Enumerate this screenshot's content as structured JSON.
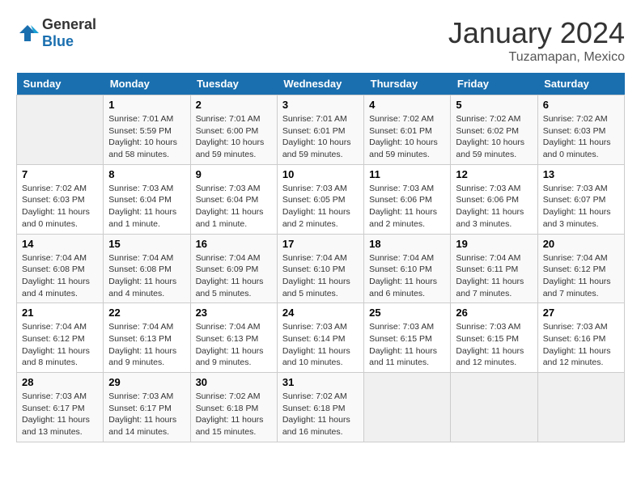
{
  "header": {
    "logo_general": "General",
    "logo_blue": "Blue",
    "month_title": "January 2024",
    "location": "Tuzamapan, Mexico"
  },
  "weekdays": [
    "Sunday",
    "Monday",
    "Tuesday",
    "Wednesday",
    "Thursday",
    "Friday",
    "Saturday"
  ],
  "weeks": [
    [
      {
        "day": "",
        "info": ""
      },
      {
        "day": "1",
        "info": "Sunrise: 7:01 AM\nSunset: 5:59 PM\nDaylight: 10 hours\nand 58 minutes."
      },
      {
        "day": "2",
        "info": "Sunrise: 7:01 AM\nSunset: 6:00 PM\nDaylight: 10 hours\nand 59 minutes."
      },
      {
        "day": "3",
        "info": "Sunrise: 7:01 AM\nSunset: 6:01 PM\nDaylight: 10 hours\nand 59 minutes."
      },
      {
        "day": "4",
        "info": "Sunrise: 7:02 AM\nSunset: 6:01 PM\nDaylight: 10 hours\nand 59 minutes."
      },
      {
        "day": "5",
        "info": "Sunrise: 7:02 AM\nSunset: 6:02 PM\nDaylight: 10 hours\nand 59 minutes."
      },
      {
        "day": "6",
        "info": "Sunrise: 7:02 AM\nSunset: 6:03 PM\nDaylight: 11 hours\nand 0 minutes."
      }
    ],
    [
      {
        "day": "7",
        "info": "Sunrise: 7:02 AM\nSunset: 6:03 PM\nDaylight: 11 hours\nand 0 minutes."
      },
      {
        "day": "8",
        "info": "Sunrise: 7:03 AM\nSunset: 6:04 PM\nDaylight: 11 hours\nand 1 minute."
      },
      {
        "day": "9",
        "info": "Sunrise: 7:03 AM\nSunset: 6:04 PM\nDaylight: 11 hours\nand 1 minute."
      },
      {
        "day": "10",
        "info": "Sunrise: 7:03 AM\nSunset: 6:05 PM\nDaylight: 11 hours\nand 2 minutes."
      },
      {
        "day": "11",
        "info": "Sunrise: 7:03 AM\nSunset: 6:06 PM\nDaylight: 11 hours\nand 2 minutes."
      },
      {
        "day": "12",
        "info": "Sunrise: 7:03 AM\nSunset: 6:06 PM\nDaylight: 11 hours\nand 3 minutes."
      },
      {
        "day": "13",
        "info": "Sunrise: 7:03 AM\nSunset: 6:07 PM\nDaylight: 11 hours\nand 3 minutes."
      }
    ],
    [
      {
        "day": "14",
        "info": "Sunrise: 7:04 AM\nSunset: 6:08 PM\nDaylight: 11 hours\nand 4 minutes."
      },
      {
        "day": "15",
        "info": "Sunrise: 7:04 AM\nSunset: 6:08 PM\nDaylight: 11 hours\nand 4 minutes."
      },
      {
        "day": "16",
        "info": "Sunrise: 7:04 AM\nSunset: 6:09 PM\nDaylight: 11 hours\nand 5 minutes."
      },
      {
        "day": "17",
        "info": "Sunrise: 7:04 AM\nSunset: 6:10 PM\nDaylight: 11 hours\nand 5 minutes."
      },
      {
        "day": "18",
        "info": "Sunrise: 7:04 AM\nSunset: 6:10 PM\nDaylight: 11 hours\nand 6 minutes."
      },
      {
        "day": "19",
        "info": "Sunrise: 7:04 AM\nSunset: 6:11 PM\nDaylight: 11 hours\nand 7 minutes."
      },
      {
        "day": "20",
        "info": "Sunrise: 7:04 AM\nSunset: 6:12 PM\nDaylight: 11 hours\nand 7 minutes."
      }
    ],
    [
      {
        "day": "21",
        "info": "Sunrise: 7:04 AM\nSunset: 6:12 PM\nDaylight: 11 hours\nand 8 minutes."
      },
      {
        "day": "22",
        "info": "Sunrise: 7:04 AM\nSunset: 6:13 PM\nDaylight: 11 hours\nand 9 minutes."
      },
      {
        "day": "23",
        "info": "Sunrise: 7:04 AM\nSunset: 6:13 PM\nDaylight: 11 hours\nand 9 minutes."
      },
      {
        "day": "24",
        "info": "Sunrise: 7:03 AM\nSunset: 6:14 PM\nDaylight: 11 hours\nand 10 minutes."
      },
      {
        "day": "25",
        "info": "Sunrise: 7:03 AM\nSunset: 6:15 PM\nDaylight: 11 hours\nand 11 minutes."
      },
      {
        "day": "26",
        "info": "Sunrise: 7:03 AM\nSunset: 6:15 PM\nDaylight: 11 hours\nand 12 minutes."
      },
      {
        "day": "27",
        "info": "Sunrise: 7:03 AM\nSunset: 6:16 PM\nDaylight: 11 hours\nand 12 minutes."
      }
    ],
    [
      {
        "day": "28",
        "info": "Sunrise: 7:03 AM\nSunset: 6:17 PM\nDaylight: 11 hours\nand 13 minutes."
      },
      {
        "day": "29",
        "info": "Sunrise: 7:03 AM\nSunset: 6:17 PM\nDaylight: 11 hours\nand 14 minutes."
      },
      {
        "day": "30",
        "info": "Sunrise: 7:02 AM\nSunset: 6:18 PM\nDaylight: 11 hours\nand 15 minutes."
      },
      {
        "day": "31",
        "info": "Sunrise: 7:02 AM\nSunset: 6:18 PM\nDaylight: 11 hours\nand 16 minutes."
      },
      {
        "day": "",
        "info": ""
      },
      {
        "day": "",
        "info": ""
      },
      {
        "day": "",
        "info": ""
      }
    ]
  ]
}
